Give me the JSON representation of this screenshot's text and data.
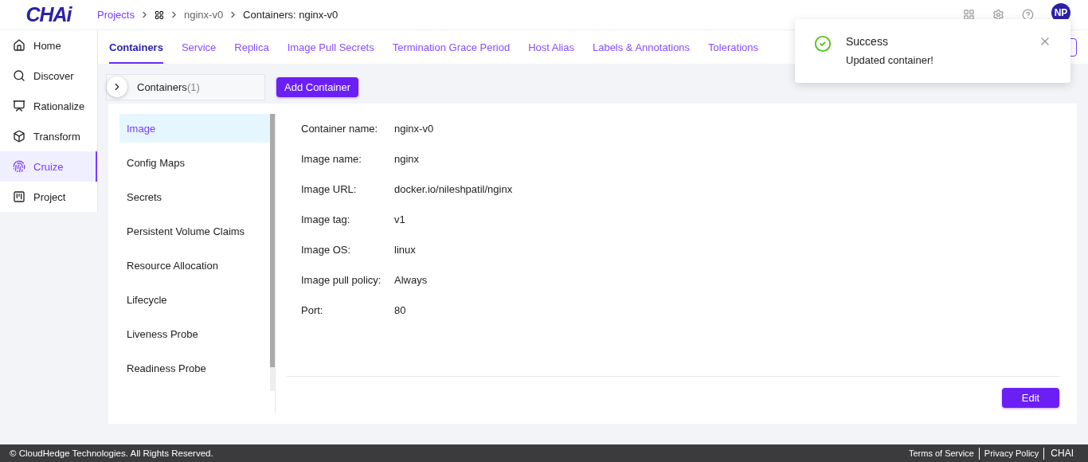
{
  "logo": "CHAi",
  "breadcrumb": [
    {
      "label": "Projects",
      "kind": "link"
    },
    {
      "kind": "grid"
    },
    {
      "label": "nginx-v0",
      "kind": "muted"
    },
    {
      "label": "Containers: nginx-v0",
      "kind": "current"
    }
  ],
  "user": {
    "initials": "NP"
  },
  "sidebar": {
    "items": [
      {
        "label": "Home",
        "selected": false
      },
      {
        "label": "Discover",
        "selected": false
      },
      {
        "label": "Rationalize",
        "selected": false
      },
      {
        "label": "Transform",
        "selected": false
      },
      {
        "label": "Cruize",
        "selected": true
      },
      {
        "label": "Project",
        "selected": false
      }
    ]
  },
  "tabs": [
    {
      "label": "Containers",
      "selected": true
    },
    {
      "label": "Service",
      "selected": false
    },
    {
      "label": "Replica",
      "selected": false
    },
    {
      "label": "Image Pull Secrets",
      "selected": false
    },
    {
      "label": "Termination Grace Period",
      "selected": false
    },
    {
      "label": "Host Alias",
      "selected": false
    },
    {
      "label": "Labels & Annotations",
      "selected": false
    },
    {
      "label": "Tolerations",
      "selected": false
    }
  ],
  "container_selector": {
    "label": "Containers",
    "count": "(1)"
  },
  "add_button": "Add Container",
  "sections": [
    {
      "label": "Image",
      "selected": true
    },
    {
      "label": "Config Maps",
      "selected": false
    },
    {
      "label": "Secrets",
      "selected": false
    },
    {
      "label": "Persistent Volume Claims",
      "selected": false
    },
    {
      "label": "Resource Allocation",
      "selected": false
    },
    {
      "label": "Lifecycle",
      "selected": false
    },
    {
      "label": "Liveness Probe",
      "selected": false
    },
    {
      "label": "Readiness Probe",
      "selected": false
    }
  ],
  "details": [
    {
      "label": "Container name:",
      "value": "nginx-v0"
    },
    {
      "label": "Image name:",
      "value": "nginx"
    },
    {
      "label": "Image URL:",
      "value": "docker.io/nileshpatil/nginx"
    },
    {
      "label": "Image tag:",
      "value": "v1"
    },
    {
      "label": "Image OS:",
      "value": "linux"
    },
    {
      "label": "Image pull policy:",
      "value": "Always"
    },
    {
      "label": "Port:",
      "value": "80"
    }
  ],
  "edit_button": "Edit",
  "toast": {
    "title": "Success",
    "message": "Updated container!"
  },
  "footer": {
    "copyright": "© CloudHedge Technologies. All Rights Reserved.",
    "links": [
      "Terms of Service",
      "Privacy Policy",
      "CHAI"
    ]
  }
}
